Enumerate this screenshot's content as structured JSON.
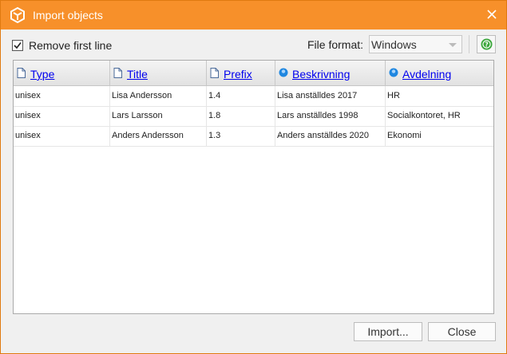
{
  "window": {
    "title": "Import objects"
  },
  "options": {
    "remove_first_line_label": "Remove first line",
    "remove_first_line_checked": true,
    "file_format_label": "File format:",
    "file_format_value": "Windows"
  },
  "table": {
    "columns": [
      {
        "label": "Type",
        "icon": "document-icon"
      },
      {
        "label": "Title",
        "icon": "document-icon"
      },
      {
        "label": "Prefix",
        "icon": "document-icon"
      },
      {
        "label": "Beskrivning",
        "icon": "info-circle-icon"
      },
      {
        "label": "Avdelning",
        "icon": "info-circle-icon"
      }
    ],
    "rows": [
      [
        "unisex",
        "Lisa Andersson",
        "1.4",
        "Lisa anställdes 2017",
        "HR"
      ],
      [
        "unisex",
        "Lars Larsson",
        "1.8",
        "Lars anställdes 1998",
        "Socialkontoret, HR"
      ],
      [
        "unisex",
        "Anders Andersson",
        "1.3",
        "Anders anställdes 2020",
        "Ekonomi"
      ]
    ]
  },
  "buttons": {
    "import": "Import...",
    "close": "Close"
  },
  "colors": {
    "titlebar": "#f7902a",
    "link": "#0000ee",
    "help_green": "#3aa63a"
  }
}
